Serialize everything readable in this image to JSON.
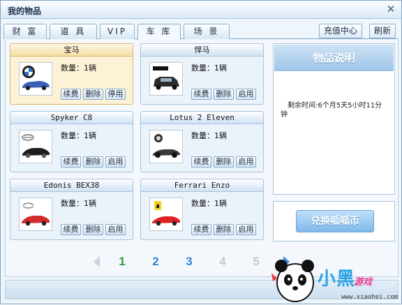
{
  "window": {
    "title": "我的物品"
  },
  "tabs": [
    {
      "label": "财 富"
    },
    {
      "label": "道 具"
    },
    {
      "label": "VIP"
    },
    {
      "label": "车 库",
      "active": true
    },
    {
      "label": "场 景"
    }
  ],
  "toolbar": {
    "recharge_label": "充值中心",
    "refresh_label": "刷新"
  },
  "items": [
    {
      "name": "宝马",
      "quantity": "数量：1辆",
      "buttons": [
        "续费",
        "删除",
        "停用"
      ],
      "selected": true,
      "logo": "bmw-logo"
    },
    {
      "name": "悍马",
      "quantity": "数量：1辆",
      "buttons": [
        "续费",
        "删除",
        "启用"
      ],
      "selected": false,
      "logo": "hummer-logo"
    },
    {
      "name": "Spyker C8",
      "quantity": "数量：1辆",
      "buttons": [
        "续费",
        "删除",
        "启用"
      ],
      "selected": false,
      "logo": "spyker-logo"
    },
    {
      "name": "Lotus 2 Eleven",
      "quantity": "数量：1辆",
      "buttons": [
        "续费",
        "删除",
        "启用"
      ],
      "selected": false,
      "logo": "lotus-logo"
    },
    {
      "name": "Edonis BEX38",
      "quantity": "数量：1辆",
      "buttons": [
        "续费",
        "删除",
        "启用"
      ],
      "selected": false,
      "logo": "edonis-logo"
    },
    {
      "name": "Ferrari Enzo",
      "quantity": "数量：1辆",
      "buttons": [
        "续费",
        "删除",
        "启用"
      ],
      "selected": false,
      "logo": "ferrari-logo"
    }
  ],
  "info_panel": {
    "title": "物品说明",
    "text": "剩余时间:6个月5天5小时11分钟"
  },
  "exchange": {
    "label": "兑换呱呱币"
  },
  "pagination": {
    "pages": [
      "1",
      "2",
      "3",
      "4",
      "5"
    ],
    "current": "1"
  },
  "watermark": {
    "main": "小黑",
    "sub": "游戏",
    "url": "www.xiaohei.com"
  },
  "colors": {
    "accent": "#3a8fe0",
    "current_page": "#2f9a3c",
    "page_active": "#2f86d4",
    "page_disabled": "#c2c9d1",
    "selected_card": "#fdf2d6"
  }
}
